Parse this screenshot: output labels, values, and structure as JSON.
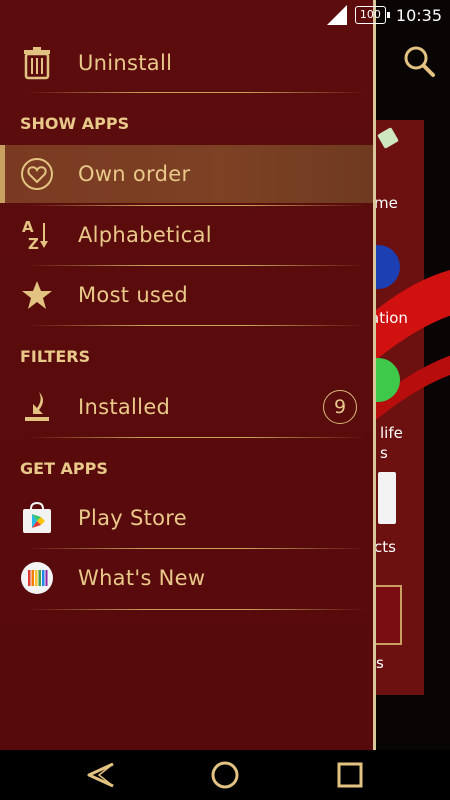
{
  "status_bar": {
    "battery": "100",
    "time": "10:35"
  },
  "drawer": {
    "uninstall": {
      "label": "Uninstall",
      "icon": "trash-icon"
    },
    "sections": {
      "show_apps": "SHOW APPS",
      "filters": "FILTERS",
      "get_apps": "GET APPS"
    },
    "show_apps_items": [
      {
        "label": "Own order",
        "icon": "heart-icon",
        "selected": true
      },
      {
        "label": "Alphabetical",
        "icon": "az-sort-icon"
      },
      {
        "label": "Most used",
        "icon": "star-icon"
      }
    ],
    "filters_items": [
      {
        "label": "Installed",
        "icon": "download-icon",
        "count": "9"
      }
    ],
    "get_apps_items": [
      {
        "label": "Play Store",
        "icon": "play-store-icon"
      },
      {
        "label": "What's New",
        "icon": "whats-new-icon"
      }
    ]
  },
  "background": {
    "labels": [
      "me",
      "ation",
      "life",
      "s",
      "cts",
      "s"
    ]
  },
  "colors": {
    "drawer_bg": "#5c0c0c",
    "gold_text": "#e9c98a",
    "selected_bg": "#7a3a22",
    "divider": "#c8a45a"
  }
}
